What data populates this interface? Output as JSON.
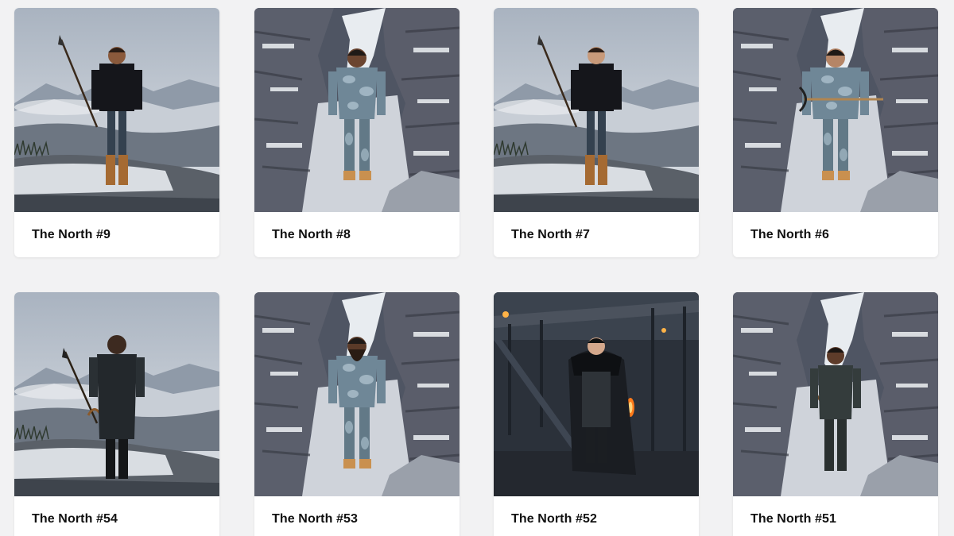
{
  "items": [
    {
      "title": "The North #9",
      "scene": "mountain",
      "figure": "tunic-spear",
      "skin": "#8a5a3c"
    },
    {
      "title": "The North #8",
      "scene": "ravine",
      "figure": "camo",
      "skin": "#6b4530"
    },
    {
      "title": "The North #7",
      "scene": "mountain",
      "figure": "tunic-spear",
      "skin": "#c89a7a"
    },
    {
      "title": "The North #6",
      "scene": "ravine",
      "figure": "camo-large",
      "skin": "#b58566"
    },
    {
      "title": "The North #54",
      "scene": "mountain",
      "figure": "armor-spear",
      "skin": "#3d2a20"
    },
    {
      "title": "The North #53",
      "scene": "ravine",
      "figure": "camo-beard",
      "skin": "#5a3a28"
    },
    {
      "title": "The North #52",
      "scene": "night-town",
      "figure": "fur-cloak",
      "skin": "#d4a88c"
    },
    {
      "title": "The North #51",
      "scene": "ravine",
      "figure": "dark-garb",
      "skin": "#5e3c2a"
    }
  ],
  "colors": {
    "page_bg": "#f2f2f3",
    "card_bg": "#ffffff",
    "title_text": "#111111"
  }
}
